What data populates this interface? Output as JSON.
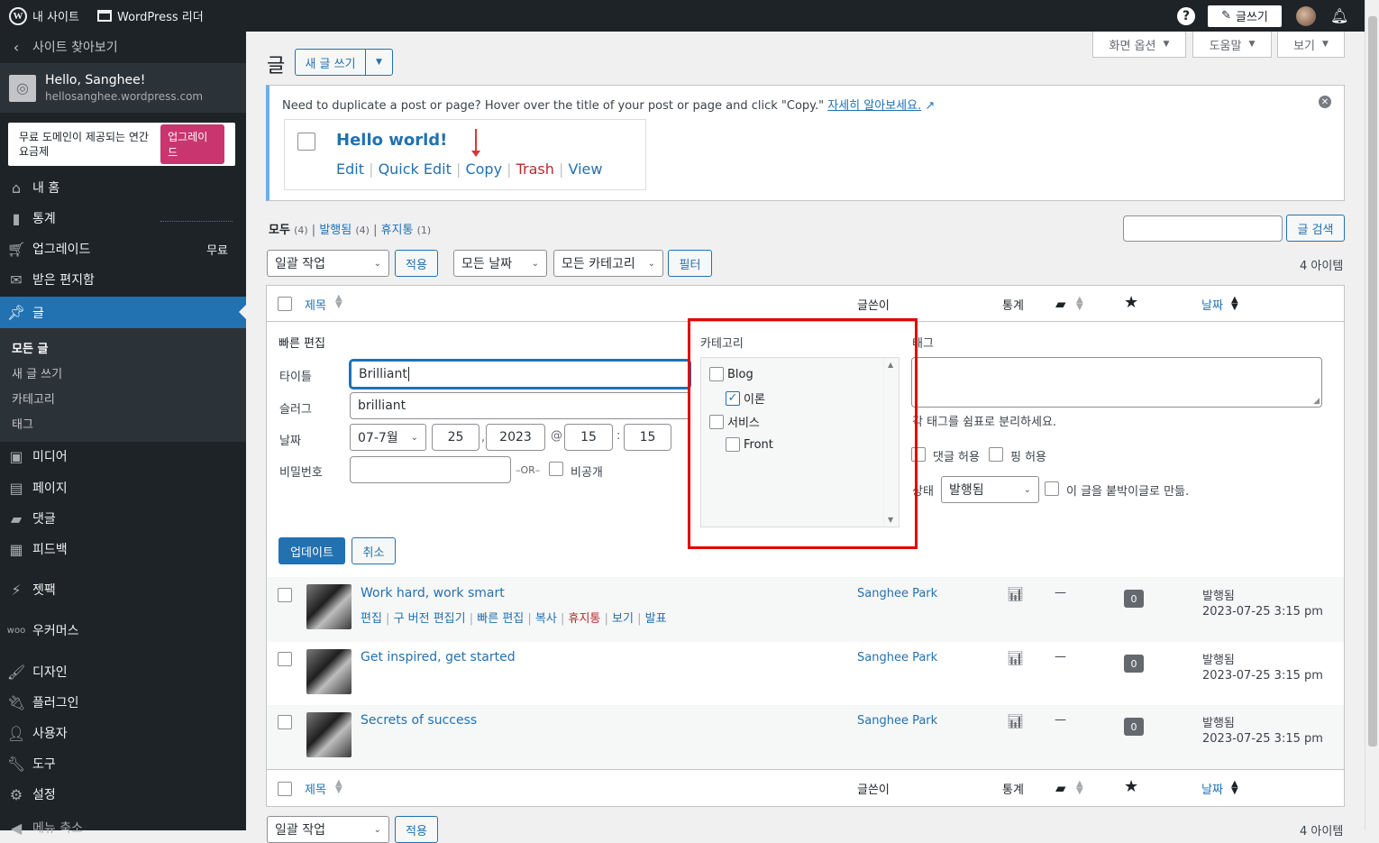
{
  "adminbar": {
    "my_site": "내 사이트",
    "reader": "WordPress 리더",
    "help": "?",
    "write": "글쓰기"
  },
  "sidebar": {
    "back": "사이트 찾아보기",
    "greeting": "Hello, Sanghee!",
    "site_url": "hellosanghee.wordpress.com",
    "promo_text": "무료 도메인이 제공되는 연간 요금제",
    "upgrade_btn": "업그레이드",
    "items": [
      {
        "label": "내 홈",
        "icon": "home-icon"
      },
      {
        "label": "통계",
        "icon": "stats-icon"
      },
      {
        "label": "업그레이드",
        "icon": "cart-icon",
        "badge": "무료"
      },
      {
        "label": "받은 편지함",
        "icon": "mail-icon"
      },
      {
        "label": "글",
        "icon": "pin-icon"
      },
      {
        "label": "미디어",
        "icon": "media-icon"
      },
      {
        "label": "페이지",
        "icon": "page-icon"
      },
      {
        "label": "댓글",
        "icon": "comment-icon"
      },
      {
        "label": "피드백",
        "icon": "feedback-icon"
      },
      {
        "label": "젯팩",
        "icon": "jetpack-icon"
      },
      {
        "label": "우커머스",
        "icon": "woo-icon"
      },
      {
        "label": "디자인",
        "icon": "brush-icon"
      },
      {
        "label": "플러그인",
        "icon": "plugin-icon"
      },
      {
        "label": "사용자",
        "icon": "user-icon"
      },
      {
        "label": "도구",
        "icon": "wrench-icon"
      },
      {
        "label": "설정",
        "icon": "settings-icon"
      },
      {
        "label": "메뉴 축소",
        "icon": "collapse-icon"
      }
    ],
    "submenu": [
      "모든 글",
      "새 글 쓰기",
      "카테고리",
      "태그"
    ]
  },
  "screen_options": {
    "screen": "화면 옵션",
    "help": "도움말",
    "view": "보기"
  },
  "page": {
    "title": "글",
    "new_post": "새 글 쓰기"
  },
  "notice": {
    "text": "Need to duplicate a post or page? Hover over the title of your post or page and click \"Copy.\"",
    "link": "자세히 알아보세요.",
    "example_title": "Hello world!",
    "actions": [
      "Edit",
      "Quick Edit",
      "Copy",
      "Trash",
      "View"
    ]
  },
  "filters": {
    "all": "모두",
    "all_count": "(4)",
    "published": "발행됨",
    "published_count": "(4)",
    "trash": "휴지통",
    "trash_count": "(1)",
    "search_btn": "글 검색",
    "bulk": "일괄 작업",
    "apply": "적용",
    "dates": "모든 날짜",
    "categories": "모든 카테고리",
    "filter": "필터",
    "items_count": "4 아이템"
  },
  "table": {
    "col_title": "제목",
    "col_author": "글쓴이",
    "col_stats": "통계",
    "col_date": "날짜"
  },
  "quick_edit": {
    "heading": "빠른 편집",
    "title_label": "타이틀",
    "title_value": "Brilliant",
    "slug_label": "슬러그",
    "slug_value": "brilliant",
    "date_label": "날짜",
    "month": "07-7월",
    "day": "25",
    "year": "2023",
    "at": "@",
    "hour": "15",
    "minute": "15",
    "password_label": "비밀번호",
    "or": "–OR–",
    "private": "비공개",
    "category_heading": "카테고리",
    "categories": [
      {
        "label": "Blog",
        "checked": false
      },
      {
        "label": "이론",
        "checked": true
      },
      {
        "label": "서비스",
        "checked": false
      },
      {
        "label": "Front",
        "checked": false
      }
    ],
    "tags_heading": "태그",
    "tags_hint": "각 태그를 쉼표로 분리하세요.",
    "allow_comments": "댓글 허용",
    "allow_pings": "핑 허용",
    "status_label": "상태",
    "status_value": "발행됨",
    "sticky": "이 글을 붙박이글로 만듦.",
    "update": "업데이트",
    "cancel": "취소"
  },
  "rows": [
    {
      "title": "Work hard, work smart",
      "author": "Sanghee Park",
      "dash": "—",
      "count": "0",
      "status": "발행됨",
      "date": "2023-07-25 3:15 pm",
      "actions": [
        "편집",
        "구 버전 편집기",
        "빠른 편집",
        "복사",
        "휴지통",
        "보기",
        "발표"
      ]
    },
    {
      "title": "Get inspired, get started",
      "author": "Sanghee Park",
      "dash": "—",
      "count": "0",
      "status": "발행됨",
      "date": "2023-07-25 3:15 pm"
    },
    {
      "title": "Secrets of success",
      "author": "Sanghee Park",
      "dash": "—",
      "count": "0",
      "status": "발행됨",
      "date": "2023-07-25 3:15 pm"
    }
  ],
  "colors": {
    "accent": "#2271b1",
    "sidebar": "#1d2327",
    "highlight": "#e00000",
    "trash": "#b32d2e"
  }
}
